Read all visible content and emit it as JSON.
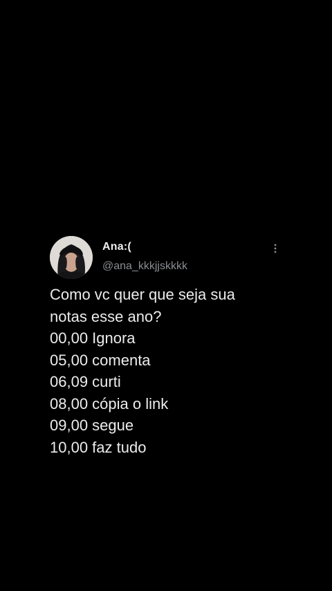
{
  "tweet": {
    "display_name": "Ana:(",
    "handle": "@ana_kkkjjskkkk",
    "avatar_icon": "profile-photo-avatar",
    "more_icon": "vertical-ellipsis-icon",
    "lines": [
      "Como vc quer que seja sua",
      "notas esse ano?",
      "00,00 Ignora",
      "05,00 comenta",
      "06,09 curti",
      "08,00 cópia o link",
      "09,00 segue",
      "10,00 faz tudo"
    ]
  },
  "colors": {
    "background": "#000000",
    "text_primary": "#ececec",
    "text_secondary": "#8a8d91"
  }
}
